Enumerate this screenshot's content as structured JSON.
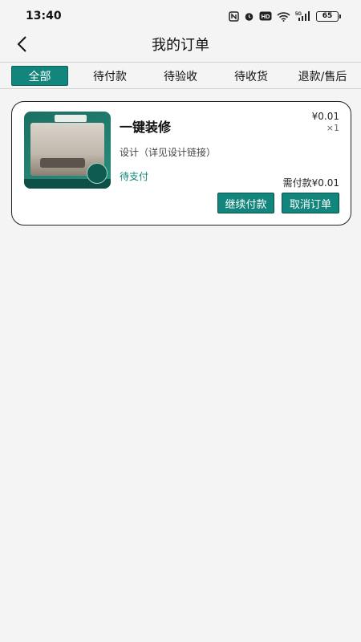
{
  "status_bar": {
    "time": "13:40",
    "icons": [
      "nfc-icon",
      "alarm-icon",
      "hd-icon",
      "wifi-icon",
      "signal-5g-icon"
    ],
    "battery": "65"
  },
  "nav": {
    "title": "我的订单",
    "back_icon": "chevron-left-icon"
  },
  "tabs": [
    {
      "label": "全部",
      "active": true
    },
    {
      "label": "待付款",
      "active": false
    },
    {
      "label": "待验收",
      "active": false
    },
    {
      "label": "待收货",
      "active": false
    },
    {
      "label": "退款/售后",
      "active": false
    }
  ],
  "orders": [
    {
      "product_name": "一键装修",
      "spec": "设计（详见设计链接）",
      "status": "待支付",
      "price": "¥0.01",
      "quantity": "×1",
      "amount_due": "需付款¥0.01",
      "thumbnail_text": "一键装修",
      "buttons": {
        "continue_pay": "继续付款",
        "cancel_order": "取消订单"
      }
    }
  ],
  "colors": {
    "accent": "#12867c",
    "background": "#f4f4f4"
  }
}
